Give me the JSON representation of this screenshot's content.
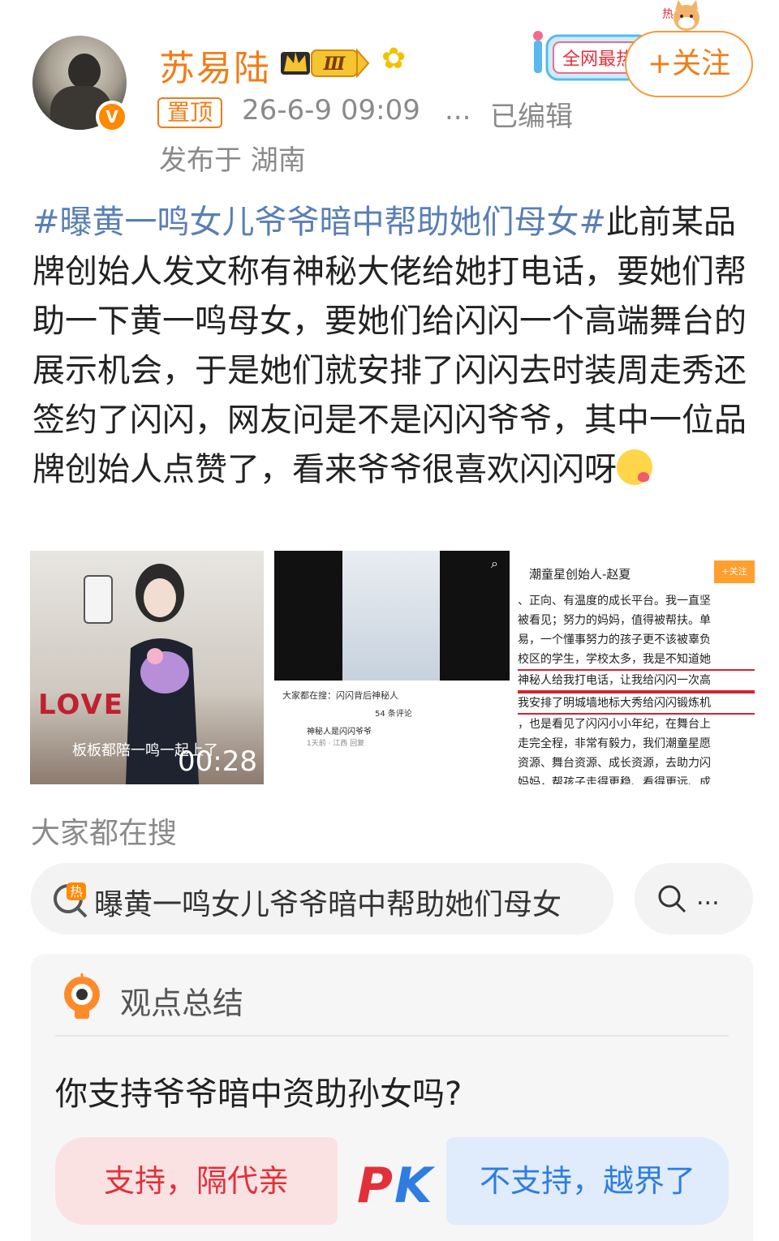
{
  "header": {
    "username": "苏易陆",
    "level_badge": "Ⅲ",
    "hot_badge": "全网最热",
    "follow_label": "+关注",
    "pin_tag": "置顶",
    "time": "26-6-9 09:09",
    "more": "...",
    "edited": "已编辑",
    "location": "发布于 湖南"
  },
  "post": {
    "hashtag": "#曝黄一鸣女儿爷爷暗中帮助她们母女#",
    "body": "此前某品牌创始人发文称有神秘大佬给她打电话，要她们帮助一下黄一鸣母女，要她们给闪闪一个高端舞台的展示机会，于是她们就安排了闪闪去时装周走秀还签约了闪闪，网友问是不是闪闪爷爷，其中一位品牌创始人点赞了，看来爷爷很喜欢闪闪呀"
  },
  "images": {
    "image1": {
      "caption": "板板都陪一鸣一起上了",
      "duration": "00:28",
      "love_text": "LOVE"
    },
    "image2": {
      "search_bar": "大家都在搜：闪闪背后神秘人",
      "comment_count": "54 条评论",
      "comment": "神秘人是闪闪爷爷",
      "comment_meta": "1天前 · 江西  回复"
    },
    "image3": {
      "title": "潮童星创始人-赵夏",
      "follow": "+关注",
      "lines": [
        "、正向、有温度的成长平台。我一直坚",
        "被看见；努力的妈妈，值得被帮扶。单",
        "易，一个懂事努力的孩子更不该被辜负",
        "校区的学生，学校太多，我是不知道她",
        "神秘人给我打电话，让我给闪闪一次高",
        "我安排了明城墙地标大秀给闪闪锻炼机",
        "，也是看见了闪闪小小年纪，在舞台上",
        "走完全程，非常有毅力，我们潮童星愿",
        "资源、舞台资源、成长资源，去助力闪",
        "妈妈，帮孩子走得更稳、看得更远、成"
      ]
    }
  },
  "search": {
    "heading": "大家都在搜",
    "term": "曝黄一鸣女儿爷爷暗中帮助她们母女",
    "more": "..."
  },
  "opinion": {
    "title": "观点总结",
    "question": "你支持爷爷暗中资助孙女吗?",
    "support": "支持，隔代亲",
    "pk": "PK",
    "oppose": "不支持，越界了"
  },
  "colors": {
    "username": "#f07d17",
    "hashtag": "#5a7fb5",
    "support": "#e2303a",
    "oppose": "#2f7de0"
  }
}
